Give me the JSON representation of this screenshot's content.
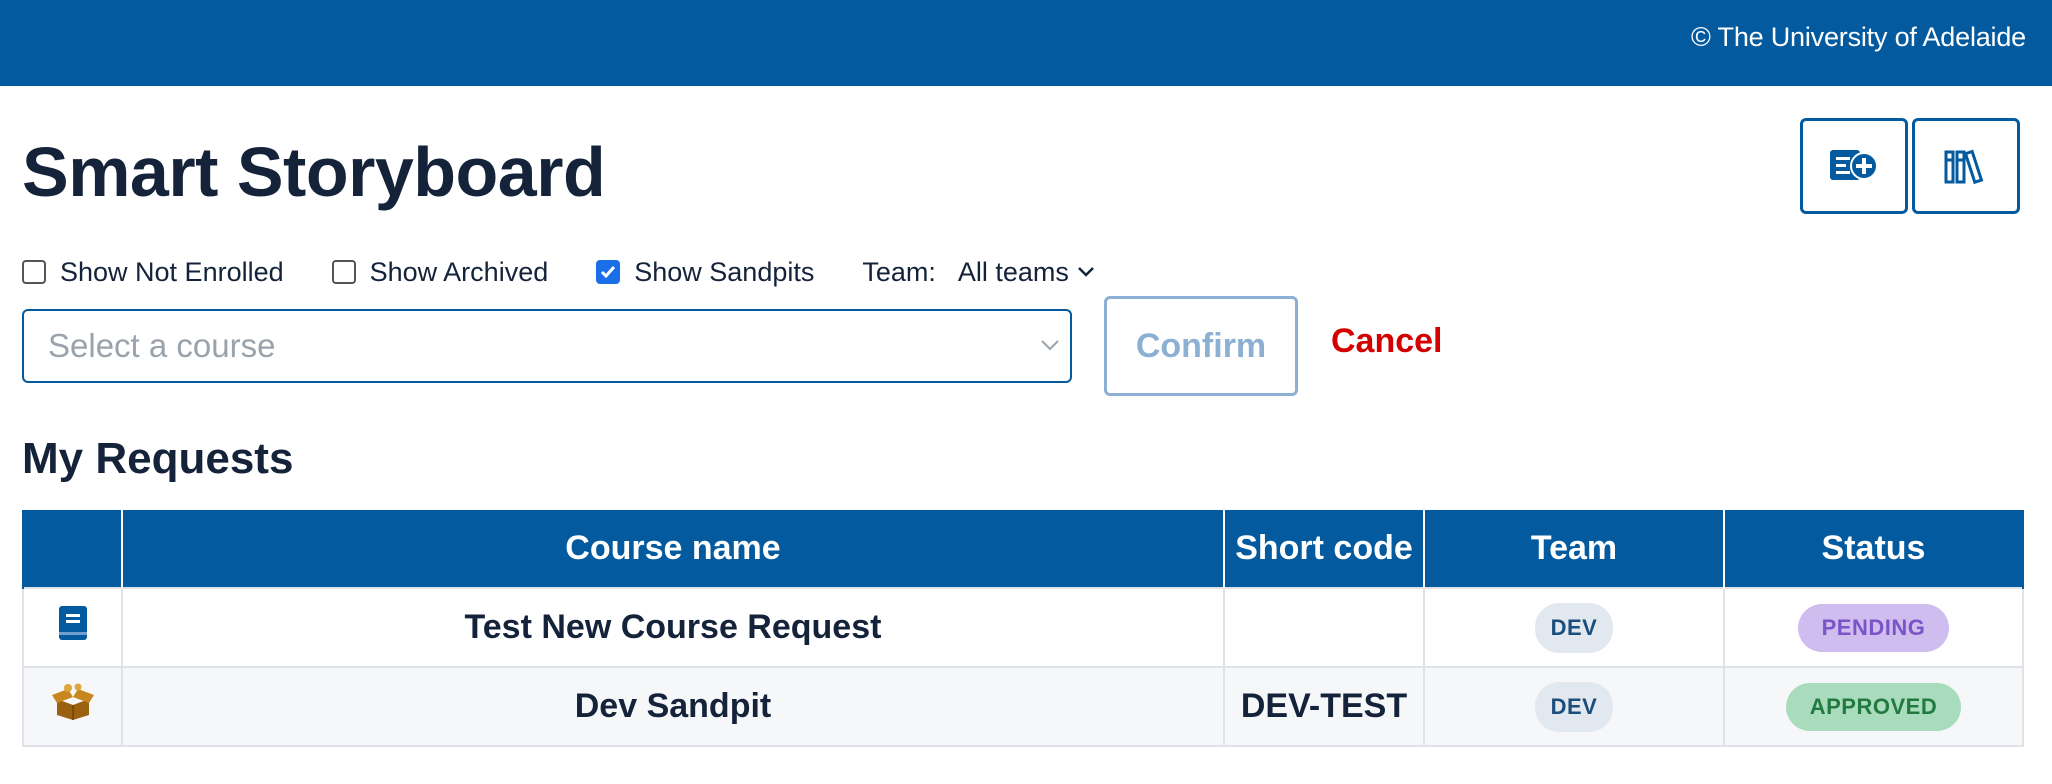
{
  "header": {
    "copyright": "© The University of Adelaide"
  },
  "page": {
    "title": "Smart Storyboard"
  },
  "toolbar_icons": [
    {
      "icon": "add-course-icon"
    },
    {
      "icon": "library-books-icon"
    }
  ],
  "filters": {
    "show_not_enrolled": {
      "label": "Show Not Enrolled",
      "checked": false
    },
    "show_archived": {
      "label": "Show Archived",
      "checked": false
    },
    "show_sandpits": {
      "label": "Show Sandpits",
      "checked": true
    },
    "team_label": "Team:",
    "team_value": "All teams"
  },
  "course_select": {
    "placeholder": "Select a course"
  },
  "actions": {
    "confirm": "Confirm",
    "cancel": "Cancel"
  },
  "requests": {
    "title": "My Requests",
    "columns": [
      "",
      "Course name",
      "Short code",
      "Team",
      "Status"
    ],
    "rows": [
      {
        "icon": "book-icon",
        "name": "Test New Course Request",
        "code": "",
        "team": "DEV",
        "status": "PENDING"
      },
      {
        "icon": "sandbox-box-icon",
        "name": "Dev Sandpit",
        "code": "DEV-TEST",
        "team": "DEV",
        "status": "APPROVED"
      }
    ]
  },
  "colors": {
    "brand": "#035a9e",
    "cancel": "#d40000",
    "pending_bg": "#cfbdf0",
    "approved_bg": "#a8dcbc"
  }
}
